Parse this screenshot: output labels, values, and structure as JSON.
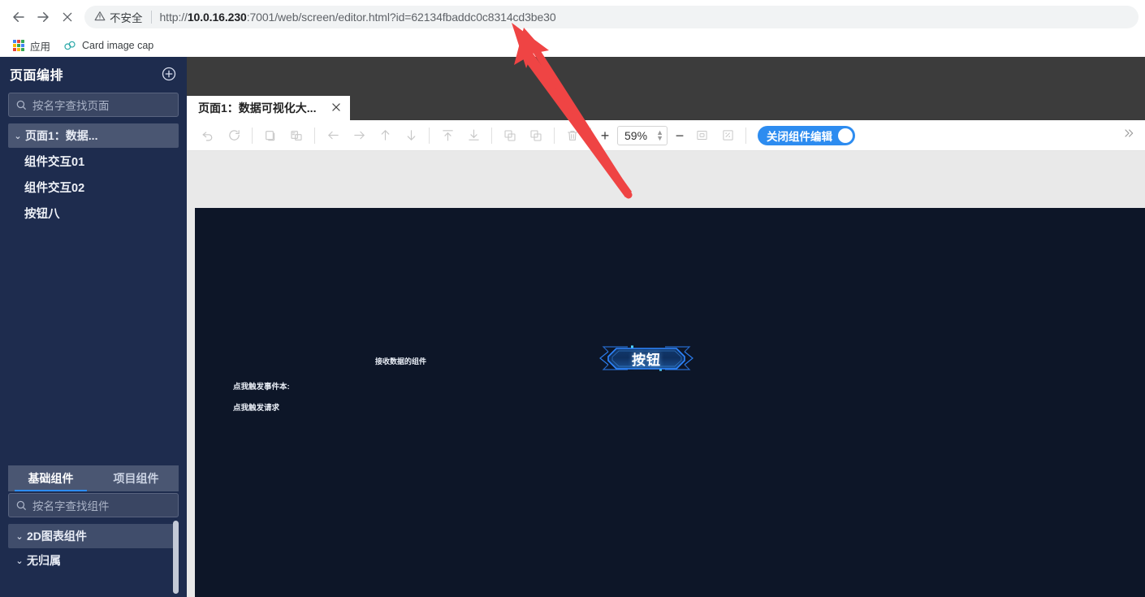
{
  "browser": {
    "nav": {
      "back_icon": "arrow-left-icon",
      "forward_icon": "arrow-right-icon",
      "stop_icon": "close-icon"
    },
    "omnibox": {
      "warning_icon": "warning-triangle-icon",
      "security_label": "不安全",
      "url_prefix": "http://",
      "url_host": "10.0.16.230",
      "url_rest": ":7001/web/screen/editor.html?id=62134fbaddc0c8314cd3be30",
      "url_full": "http://10.0.16.230:7001/web/screen/editor.html?id=62134fbaddc0c8314cd3be30"
    },
    "bookmarks": [
      {
        "icon": "apps-grid-icon",
        "label": "应用"
      },
      {
        "icon": "link-chain-icon",
        "label": "Card image cap"
      }
    ]
  },
  "sidebar": {
    "pages": {
      "title": "页面编排",
      "add_icon": "plus-circle-icon",
      "search_placeholder": "按名字查找页面",
      "search_icon": "search-icon",
      "tree": {
        "caret": "⌄",
        "root_label": "页面1：数据...",
        "children": [
          {
            "label": "组件交互01"
          },
          {
            "label": "组件交互02"
          },
          {
            "label": "按钮八"
          }
        ]
      }
    },
    "components": {
      "tabs": [
        {
          "label": "基础组件",
          "active": true
        },
        {
          "label": "项目组件",
          "active": false
        }
      ],
      "search_placeholder": "按名字查找组件",
      "search_icon": "search-icon",
      "categories": [
        {
          "label": "2D图表组件",
          "caret": "⌄",
          "highlight": true
        },
        {
          "label": "无归属",
          "caret": "⌄",
          "highlight": false
        }
      ]
    }
  },
  "editor": {
    "tab": {
      "label": "页面1：数据可视化大...",
      "close_icon": "close-icon"
    },
    "toolbar": {
      "buttons": [
        {
          "name": "undo-button",
          "icon": "undo-icon"
        },
        {
          "name": "redo-button",
          "icon": "redo-icon"
        },
        {
          "name": "copy-button",
          "icon": "copy-icon"
        },
        {
          "name": "paste-button",
          "icon": "paste-icon"
        },
        {
          "name": "align-left-button",
          "icon": "arrow-left-icon"
        },
        {
          "name": "align-right-button",
          "icon": "arrow-right-icon"
        },
        {
          "name": "align-up-button",
          "icon": "arrow-up-icon"
        },
        {
          "name": "align-down-button",
          "icon": "arrow-down-icon"
        },
        {
          "name": "bring-to-front-button",
          "icon": "arrow-up-bar-icon"
        },
        {
          "name": "send-to-back-button",
          "icon": "arrow-down-bar-icon"
        },
        {
          "name": "group-button",
          "icon": "group-icon"
        },
        {
          "name": "ungroup-button",
          "icon": "ungroup-icon"
        },
        {
          "name": "delete-button",
          "icon": "trash-icon"
        }
      ],
      "zoom_in_label": "+",
      "zoom_value": "59%",
      "zoom_out_label": "−",
      "fit_icon": "fit-screen-icon",
      "fullscreen_icon": "fullscreen-icon",
      "edit_toggle_label": "关闭组件编辑",
      "overflow_icon": "chevron-double-right-icon"
    },
    "canvas": {
      "background_color": "#0d1628",
      "texts": [
        {
          "name": "receiver-component-label",
          "label": "接收数据的组件"
        },
        {
          "name": "trigger-event-label",
          "label": "点我触发事件本:"
        },
        {
          "name": "trigger-request-label",
          "label": "点我触发请求"
        }
      ],
      "button_widget": {
        "label": "按钮",
        "border_color": "#2f86ff",
        "accent_color": "#4fd4ff"
      }
    }
  },
  "annotation": {
    "arrow_color": "#ef4444",
    "name": "red-pointer-arrow"
  }
}
